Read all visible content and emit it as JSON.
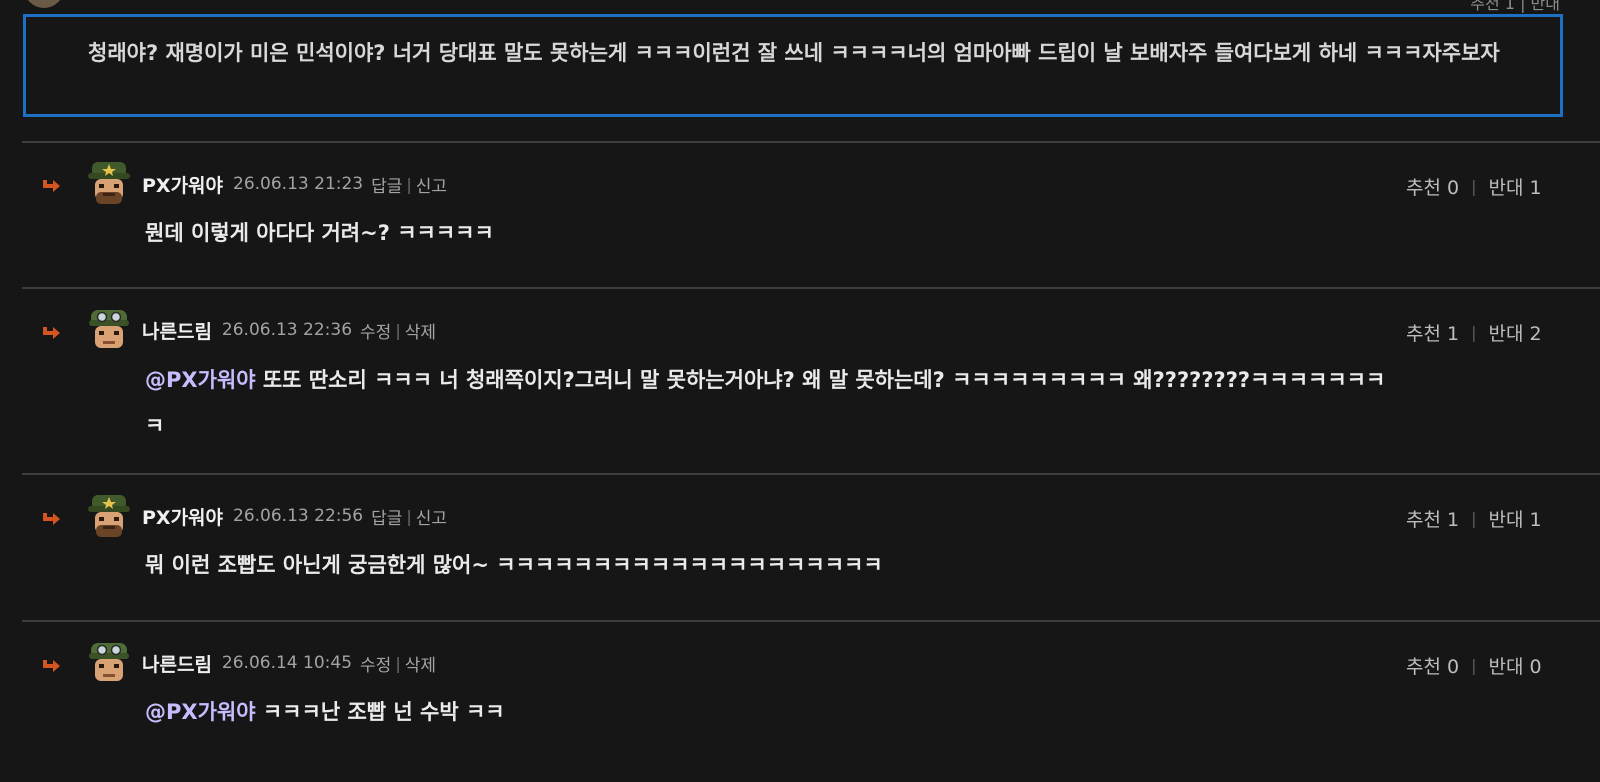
{
  "top_partial": {
    "votes_label": "추천 1 | 반대"
  },
  "reply_input": {
    "text": "청래야? 재명이가 미은 민석이야? 너거 당대표 말도 못하는게 ㅋㅋㅋ이런건 잘 쓰네 ㅋㅋㅋㅋ너의 엄마아빠 드립이 날 보배자주 들여다보게 하네 ㅋㅋㅋ자주보자",
    "border_color": "#1e70c4"
  },
  "labels": {
    "recommend": "추천",
    "oppose": "반대"
  },
  "comments": [
    {
      "author": "PX가워야",
      "avatar_icon": "soldier-general-avatar-icon",
      "date": "26.06.13 21:23",
      "action1": "답글",
      "action2": "신고",
      "recommend_count": "0",
      "oppose_count": "1",
      "mention": "",
      "text": "뭔데 이렇게 아다다 거려~? ㅋㅋㅋㅋㅋ"
    },
    {
      "author": "나른드림",
      "avatar_icon": "soldier-goggles-avatar-icon",
      "date": "26.06.13 22:36",
      "action1": "수정",
      "action2": "삭제",
      "recommend_count": "1",
      "oppose_count": "2",
      "mention": "@PX가워야",
      "text": " 또또 딴소리 ㅋㅋㅋ 너 청래쪽이지?그러니 말 못하는거아냐? 왜 말 못하는데? ㅋㅋㅋㅋㅋㅋㅋㅋㅋ 왜????????ㅋㅋㅋㅋㅋㅋㅋㅋ"
    },
    {
      "author": "PX가워야",
      "avatar_icon": "soldier-general-avatar-icon",
      "date": "26.06.13 22:56",
      "action1": "답글",
      "action2": "신고",
      "recommend_count": "1",
      "oppose_count": "1",
      "mention": "",
      "text": "뭐 이런 조빱도 아닌게 궁금한게 많어~ ㅋㅋㅋㅋㅋㅋㅋㅋㅋㅋㅋㅋㅋㅋㅋㅋㅋㅋㅋㅋ"
    },
    {
      "author": "나른드림",
      "avatar_icon": "soldier-goggles-avatar-icon",
      "date": "26.06.14 10:45",
      "action1": "수정",
      "action2": "삭제",
      "recommend_count": "0",
      "oppose_count": "0",
      "mention": "@PX가워야",
      "text": " ㅋㅋㅋ난 조빱 넌 수박 ㅋㅋ"
    }
  ],
  "colors": {
    "background": "#161616",
    "divider": "#3d3d3d",
    "mention": "#c6bdff",
    "reply_arrow": "#d4551f"
  }
}
